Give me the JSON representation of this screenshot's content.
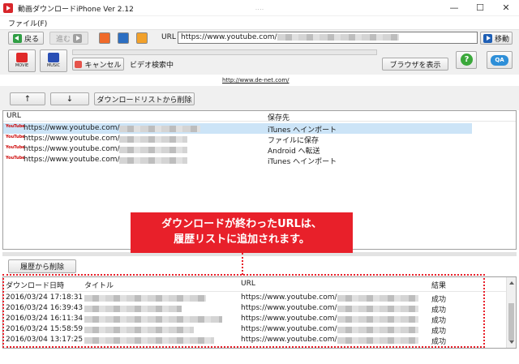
{
  "window": {
    "title": "動画ダウンロードiPhone Ver 2.12",
    "minimize_glyph": "—",
    "maximize_glyph": "☐",
    "close_glyph": "✕"
  },
  "menu": {
    "file": "ファイル(F)"
  },
  "nav": {
    "back_label": "戻る",
    "forward_label": "進む",
    "url_label": "URL",
    "url_value": "https://www.youtube.com/",
    "go_label": "移動"
  },
  "toolbar": {
    "movie_label": "MOVIE",
    "music_label": "MUSIC",
    "cancel_label": "キャンセル",
    "status_text": "ビデオ検索中",
    "show_browser_label": "ブラウザを表示",
    "help_glyph": "?",
    "qa_glyph": "QA"
  },
  "link_text": "http://www.de-net.com/",
  "controls": {
    "up_label": "↑",
    "down_label": "↓",
    "remove_label": "ダウンロードリストから削除"
  },
  "download_list": {
    "headers": {
      "url": "URL",
      "dest": "保存先"
    },
    "rows": [
      {
        "icon": "YouTube",
        "url": "https://www.youtube.com/",
        "dest": "iTunes へインポート",
        "selected": true
      },
      {
        "icon": "YouTube",
        "url": "https://www.youtube.com/",
        "dest": "ファイルに保存",
        "selected": false
      },
      {
        "icon": "YouTube",
        "url": "https://www.youtube.com/",
        "dest": "Android へ転送",
        "selected": false
      },
      {
        "icon": "YouTube",
        "url": "https://www.youtube.com/",
        "dest": "iTunes へインポート",
        "selected": false
      }
    ]
  },
  "callout": {
    "line1": "ダウンロードが終わったURLは、",
    "line2": "履歴リストに追加されます。"
  },
  "history": {
    "delete_label": "履歴から削除",
    "headers": {
      "date": "ダウンロード日時",
      "title": "タイトル",
      "url": "URL",
      "result": "結果"
    },
    "rows": [
      {
        "date": "2016/03/24 17:18:31",
        "url": "https://www.youtube.com/",
        "result": "成功"
      },
      {
        "date": "2016/03/24 16:39:43",
        "url": "https://www.youtube.com/",
        "result": "成功"
      },
      {
        "date": "2016/03/24 16:11:34",
        "url": "https://www.youtube.com/",
        "result": "成功"
      },
      {
        "date": "2016/03/24 15:58:59",
        "url": "https://www.youtube.com/",
        "result": "成功"
      },
      {
        "date": "2016/03/04 13:17:25",
        "url": "https://www.youtube.com/",
        "result": "成功"
      }
    ]
  },
  "colors": {
    "accent_red": "#e8202a",
    "selection": "#cce4f7",
    "go_blue": "#1f5fb5",
    "back_green": "#2f9e44"
  }
}
